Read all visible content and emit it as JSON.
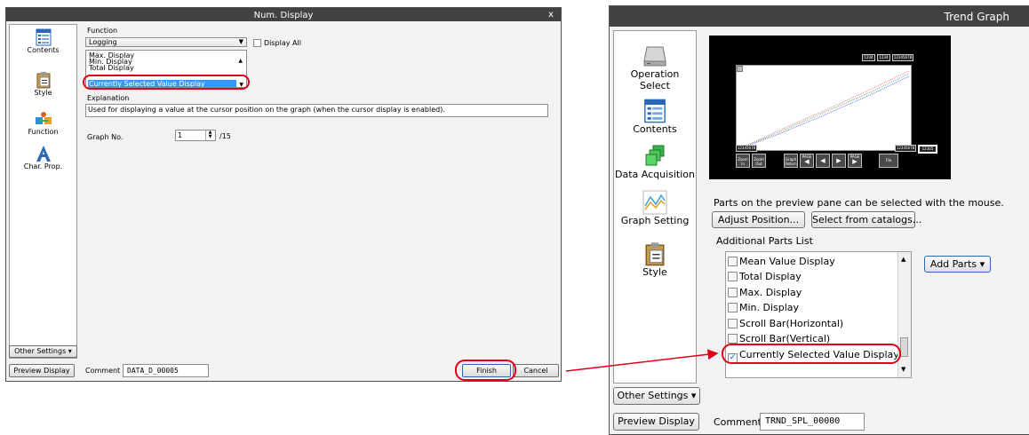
{
  "left_dialog": {
    "title": "Num. Display",
    "close_glyph": "x",
    "nav": [
      {
        "label": "Contents",
        "icon": "contents-icon"
      },
      {
        "label": "Style",
        "icon": "style-icon"
      },
      {
        "label": "Function",
        "icon": "function-icon"
      },
      {
        "label": "Char. Prop.",
        "icon": "char-prop-icon"
      }
    ],
    "function_label": "Function",
    "function_value": "Logging",
    "display_all_label": "Display All",
    "list_items": [
      "Max. Display",
      "Min. Display",
      "Total Display",
      "Currently Selected Value Display"
    ],
    "explanation_label": "Explanation",
    "explanation_text": "Used for displaying a value at the cursor position on the graph (when the cursor display is enabled).",
    "graph_no_label": "Graph No.",
    "graph_no_value": "1",
    "graph_no_max": "/15",
    "other_settings": "Other Settings",
    "preview_display": "Preview Display",
    "comment_label": "Comment",
    "comment_value": "DATA_D_00005",
    "finish": "Finish",
    "cancel": "Cancel"
  },
  "right_dialog": {
    "title": "Trend Graph",
    "nav": [
      {
        "label": "Operation Select",
        "icon": "operation-select-icon"
      },
      {
        "label": "Contents",
        "icon": "contents-icon"
      },
      {
        "label": "Data Acquisition",
        "icon": "data-acquisition-icon"
      },
      {
        "label": "Graph Setting",
        "icon": "graph-setting-icon"
      },
      {
        "label": "Style",
        "icon": "style-icon"
      }
    ],
    "preview": {
      "top_tags": [
        "1234",
        "1234",
        "12345678"
      ],
      "left_tag": "12345678",
      "right_tags": [
        "12345678",
        "12345"
      ],
      "buttons": [
        "Zoom In",
        "Zoom Out",
        "Graph Return",
        "PAGE",
        "PAGE",
        "File"
      ]
    },
    "hint": "Parts on the preview pane can be selected with the mouse.",
    "adjust_position": "Adjust Position...",
    "select_from_catalogs": "Select from catalogs...",
    "additional_parts_label": "Additional Parts List",
    "parts": [
      {
        "label": "Mean Value Display",
        "checked": false
      },
      {
        "label": "Total Display",
        "checked": false
      },
      {
        "label": "Max. Display",
        "checked": false
      },
      {
        "label": "Min. Display",
        "checked": false
      },
      {
        "label": "Scroll Bar(Horizontal)",
        "checked": false
      },
      {
        "label": "Scroll Bar(Vertical)",
        "checked": false
      },
      {
        "label": "Currently Selected Value Display",
        "checked": true
      }
    ],
    "add_parts": "Add Parts",
    "other_settings": "Other Settings",
    "preview_display": "Preview Display",
    "comment_label": "Comment",
    "comment_value": "TRND_SPL_00000"
  },
  "colors": {
    "titlebar": "#424242",
    "selection": "#3399ff",
    "annotation_red": "#e0001a"
  }
}
